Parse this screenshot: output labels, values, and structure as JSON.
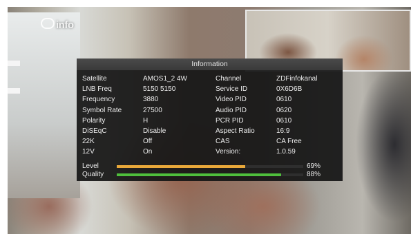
{
  "logo": {
    "text": "info"
  },
  "panel": {
    "title": "Information",
    "rows": [
      {
        "label1": "Satellite",
        "value1": "AMOS1_2 4W",
        "label2": "Channel",
        "value2": "ZDFinfokanal"
      },
      {
        "label1": "LNB Freq",
        "value1": "5150 5150",
        "label2": "Service ID",
        "value2": "0X6D6B"
      },
      {
        "label1": "Frequency",
        "value1": "3880",
        "label2": "Video PID",
        "value2": "0610"
      },
      {
        "label1": "Symbol Rate",
        "value1": "27500",
        "label2": "Audio PID",
        "value2": "0620"
      },
      {
        "label1": "Polarity",
        "value1": "H",
        "label2": "PCR PID",
        "value2": "0610"
      },
      {
        "label1": "DiSEqC",
        "value1": "Disable",
        "label2": "Aspect Ratio",
        "value2": "16:9"
      },
      {
        "label1": "22K",
        "value1": "Off",
        "label2": "CAS",
        "value2": "CA Free"
      },
      {
        "label1": "12V",
        "value1": "On",
        "label2": "Version:",
        "value2": "1.0.59"
      }
    ],
    "level": {
      "label": "Level",
      "percent": 69,
      "text": "69%",
      "color": "#e9a83a"
    },
    "quality": {
      "label": "Quality",
      "percent": 88,
      "text": "88%",
      "color": "#4fbf3c"
    }
  }
}
